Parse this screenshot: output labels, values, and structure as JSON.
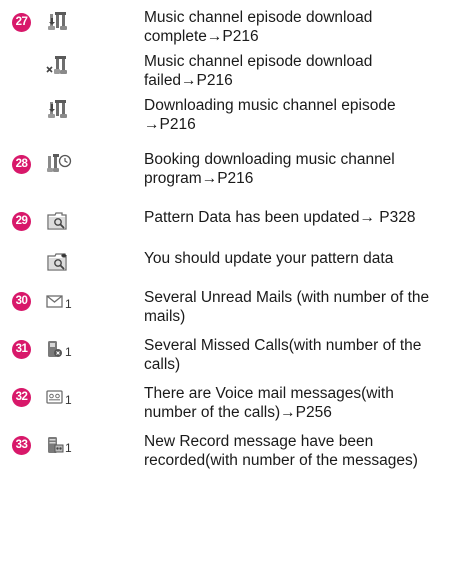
{
  "entries": [
    {
      "badge": "27",
      "icon": "music-download-complete-icon",
      "text": "Music channel episode download complete→P216"
    },
    {
      "badge": "",
      "icon": "music-download-failed-icon",
      "text": "Music channel episode download failed→P216"
    },
    {
      "badge": "",
      "icon": "music-downloading-icon",
      "text": "Downloading music channel episode →P216"
    },
    {
      "badge": "28",
      "icon": "music-booking-icon",
      "text": "Booking downloading music channel program→P216"
    },
    {
      "badge": "29",
      "icon": "pattern-updated-icon",
      "text": "Pattern Data has been updated→ P328"
    },
    {
      "badge": "",
      "icon": "pattern-update-needed-icon",
      "text": "You should update your pattern data"
    },
    {
      "badge": "30",
      "icon": "unread-mail-icon",
      "icon_count": "1",
      "text": "Several Unread Mails (with number of the mails)"
    },
    {
      "badge": "31",
      "icon": "missed-call-icon",
      "icon_count": "1",
      "text": "Several Missed Calls(with number of the calls)"
    },
    {
      "badge": "32",
      "icon": "voicemail-icon",
      "icon_count": "1",
      "text": "There are Voice mail messages(with number of the calls)→P256"
    },
    {
      "badge": "33",
      "icon": "record-message-icon",
      "icon_count": "1",
      "text": "New Record message have been recorded(with number of the messages)"
    }
  ],
  "colors": {
    "badge": "#d8186a",
    "icon": "#7a7a7a"
  }
}
